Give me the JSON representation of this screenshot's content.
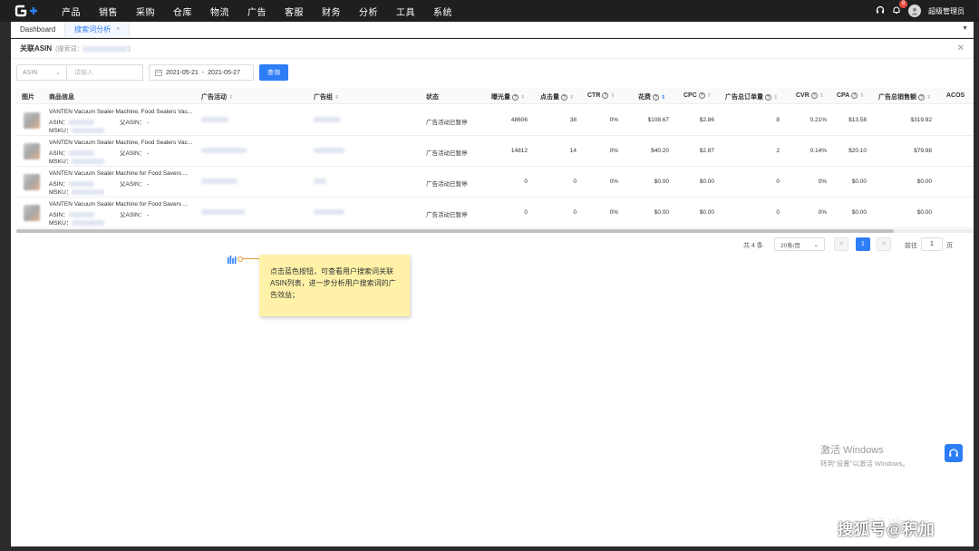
{
  "nav": {
    "items": [
      "产品",
      "销售",
      "采购",
      "仓库",
      "物流",
      "广告",
      "客服",
      "财务",
      "分析",
      "工具",
      "系统"
    ],
    "notif_count": "8",
    "user": "超级管理员"
  },
  "tabs": {
    "dashboard": "Dashboard",
    "active": "搜索词分析",
    "close": "×"
  },
  "panel": {
    "title": "关联ASIN",
    "subtitle": "(搜索词：",
    "subtitle_end": ")"
  },
  "filters": {
    "select_value": "ASIN",
    "input_placeholder": "请输入",
    "date_start": "2021-05-21",
    "date_sep": "-",
    "date_end": "2021-05-27",
    "search_button": "查询"
  },
  "columns": {
    "image": "图片",
    "product": "商品信息",
    "campaign": "广告活动",
    "ad_group": "广告组",
    "status": "状态",
    "impressions": "曝光量",
    "clicks": "点击量",
    "ctr": "CTR",
    "spend": "花费",
    "cpc": "CPC",
    "orders": "广告总订单量",
    "cvr": "CVR",
    "cpa": "CPA",
    "sales": "广告总销售额",
    "acos": "ACOS"
  },
  "row_labels": {
    "asin": "ASIN：",
    "parent_asin": "父ASIN：",
    "parent_value": "-",
    "msku": "MSKU："
  },
  "rows": [
    {
      "name": "VANTEN Vacuum Sealer Machine, Food Sealers Vac...",
      "status": "广告活动已暂停",
      "impressions": "48606",
      "clicks": "38",
      "ctr": "0%",
      "spend": "$108.67",
      "cpc": "$2.86",
      "orders": "8",
      "cvr": "0.21%",
      "cpa": "$13.58",
      "sales": "$319.92"
    },
    {
      "name": "VANTEN Vacuum Sealer Machine, Food Sealers Vac...",
      "status": "广告活动已暂停",
      "impressions": "14812",
      "clicks": "14",
      "ctr": "0%",
      "spend": "$40.20",
      "cpc": "$2.87",
      "orders": "2",
      "cvr": "0.14%",
      "cpa": "$20.10",
      "sales": "$79.98"
    },
    {
      "name": "VANTEN Vacuum Sealer Machine for Food Savers ...",
      "status": "广告活动已暂停",
      "impressions": "0",
      "clicks": "0",
      "ctr": "0%",
      "spend": "$0.00",
      "cpc": "$0.00",
      "orders": "0",
      "cvr": "0%",
      "cpa": "$0.00",
      "sales": "$0.00"
    },
    {
      "name": "VANTEN Vacuum Sealer Machine for Food Savers ...",
      "status": "广告活动已暂停",
      "impressions": "0",
      "clicks": "0",
      "ctr": "0%",
      "spend": "$0.00",
      "cpc": "$0.00",
      "orders": "0",
      "cvr": "0%",
      "cpa": "$0.00",
      "sales": "$0.00"
    }
  ],
  "pager": {
    "total": "共 4 条",
    "page_size": "20条/页",
    "prev": "<",
    "current": "1",
    "next": ">",
    "goto": "前往",
    "goto_value": "1",
    "page_unit": "页"
  },
  "note": {
    "text": "点击蓝色按钮，可查看用户搜索词关联ASIN列表，进一步分析用户搜索词的广告效益；"
  },
  "windows": {
    "activate_title": "激活 Windows",
    "activate_sub": "转到\"设置\"以激活 Windows。",
    "ghost": "激活 Windows"
  },
  "watermark": "搜狐号@积加",
  "colors": {
    "accent": "#2d7df6",
    "topbar": "#1f1f1f",
    "note_bg": "#fff2a8"
  }
}
